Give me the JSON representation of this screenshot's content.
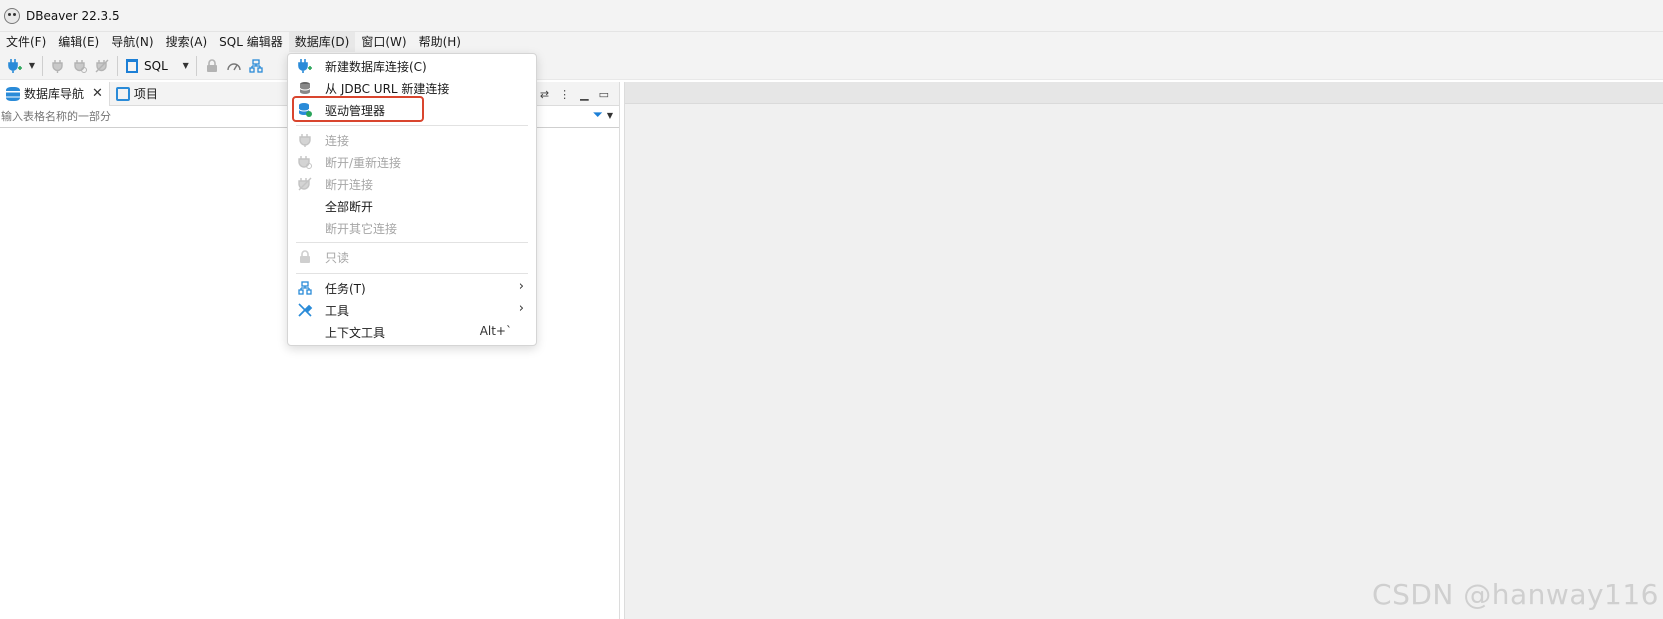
{
  "window": {
    "title": "DBeaver 22.3.5"
  },
  "menubar": {
    "items": [
      "文件(F)",
      "编辑(E)",
      "导航(N)",
      "搜索(A)",
      "SQL 编辑器",
      "数据库(D)",
      "窗口(W)",
      "帮助(H)"
    ]
  },
  "toolbar": {
    "sql_label": "SQL",
    "icons": [
      "new-connection-icon",
      "dropdown-arrow-icon",
      "connect-icon",
      "reconnect-icon",
      "disconnect-icon",
      "sql-editor-icon",
      "lock-icon",
      "dashboard-icon",
      "tasks-icon"
    ]
  },
  "navigator": {
    "tabs": [
      {
        "label": "数据库导航",
        "icon": "database-icon"
      },
      {
        "label": "项目",
        "icon": "project-icon"
      }
    ],
    "filter_placeholder": "输入表格名称的一部分"
  },
  "database_menu": {
    "items": [
      {
        "label": "新建数据库连接(C)",
        "icon": "new-connection-icon",
        "enabled": true
      },
      {
        "label": "从 JDBC URL 新建连接",
        "icon": "database-stack-icon",
        "enabled": true
      },
      {
        "label": "驱动管理器",
        "icon": "driver-manager-icon",
        "enabled": true,
        "highlighted": true
      },
      {
        "label": "连接",
        "icon": "connect-icon",
        "enabled": false
      },
      {
        "label": "断开/重新连接",
        "icon": "reconnect-icon",
        "enabled": false
      },
      {
        "label": "断开连接",
        "icon": "disconnect-icon",
        "enabled": false
      },
      {
        "label": "全部断开",
        "enabled": true
      },
      {
        "label": "断开其它连接",
        "enabled": false
      },
      {
        "label": "只读",
        "icon": "lock-icon",
        "enabled": false
      },
      {
        "label": "任务(T)",
        "icon": "tasks-icon",
        "enabled": true,
        "submenu": true
      },
      {
        "label": "工具",
        "icon": "tools-icon",
        "enabled": true,
        "submenu": true
      },
      {
        "label": "上下文工具",
        "enabled": true,
        "shortcut": "Alt+`"
      }
    ]
  },
  "watermark": "CSDN @hanway116",
  "colors": {
    "accent": "#2a8bd8",
    "highlight_border": "#d9452e",
    "disabled_text": "#a6a6a6"
  }
}
